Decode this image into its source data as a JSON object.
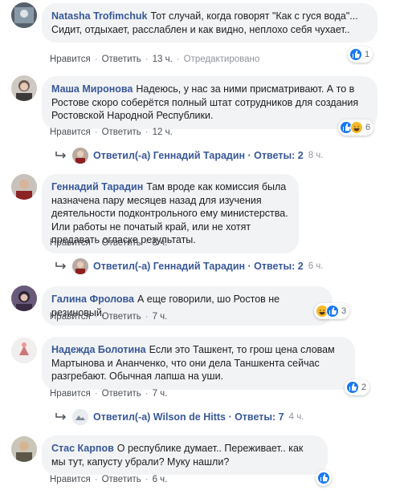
{
  "actions_common": {
    "like": "Нравится",
    "reply": "Ответить",
    "dot": "·"
  },
  "comments": [
    {
      "author": "Natasha Trofimchuk",
      "text": "Тот случай, когда говорят \"Как с гуся вода\"... Сидит, отдыхает, расслаблен и как видно, неплохо себя чухает..",
      "time": "13 ч.",
      "edited": "Отредактировано",
      "reactions": {
        "types": [
          "like"
        ],
        "count": "1"
      }
    },
    {
      "author": "Маша Миронова",
      "text": "Надеюсь, у нас за ними присматривают. А то в Ростове скоро соберётся полный штат сотрудников для создания Ростовской Народной Республики.",
      "time": "12 ч.",
      "reactions": {
        "types": [
          "like",
          "haha"
        ],
        "count": "6"
      },
      "reply_summary": {
        "label": "Ответил(-а) Геннадий Тарадин · Ответы: 2",
        "time": "8 ч."
      }
    },
    {
      "author": "Геннадий Тарадин",
      "text": "Там вроде как комиссия была назначена пару месяцев назад для изучения деятельности подконтрольного ему министерства. Или работы не початый край, или не хотят предавать огласке результаты.",
      "time": "8 ч.",
      "reply_summary": {
        "label": "Ответил(-а) Геннадий Тарадин · Ответы: 2",
        "time": "6 ч."
      }
    },
    {
      "author": "Галина Фролова",
      "text": "А еще говорили, шо Ростов не резиновый.",
      "time": "7 ч.",
      "reactions": {
        "types": [
          "haha",
          "like"
        ],
        "count": "3"
      }
    },
    {
      "author": "Надежда Болотина",
      "text": "Если это Ташкент, то грош цена словам Мартынова и Ананченко, что они дела Таншкента сейчас разгребают. Обычная лапша на уши.",
      "time": "7 ч.",
      "reactions": {
        "types": [
          "like"
        ],
        "count": "2"
      },
      "reply_summary": {
        "label": "Ответил(-а) Wilson de Hitts · Ответы: 7",
        "time": "4 ч."
      }
    },
    {
      "author": "Стас Карпов",
      "text": "О республике думает.. Переживает.. как мы тут, капусту убрали? Муку нашли?",
      "time": "6 ч.",
      "reactions": {
        "types": [
          "like"
        ],
        "count": ""
      }
    }
  ],
  "colors": {
    "author": "#385898",
    "like": "#1877f2",
    "haha": "#f7b928",
    "bubble": "#f2f3f5"
  }
}
